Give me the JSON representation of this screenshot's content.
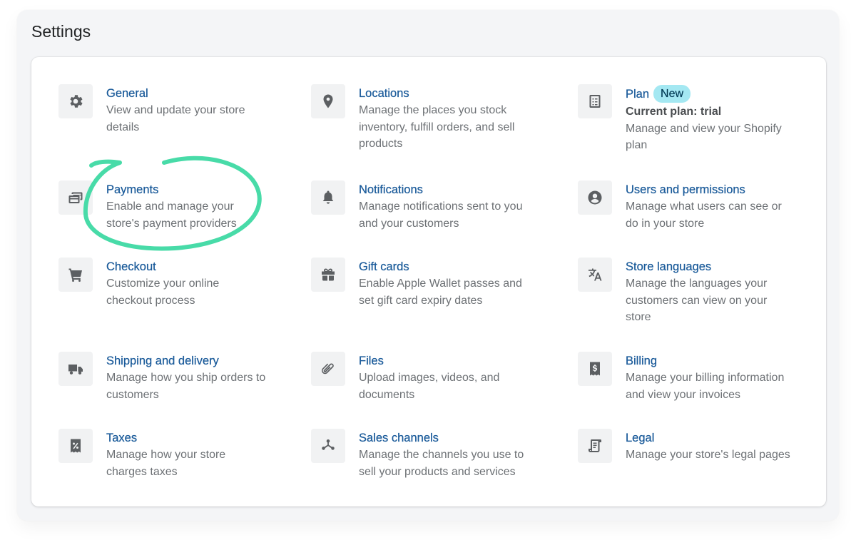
{
  "page": {
    "title": "Settings"
  },
  "annotation_color": "#3ed9a3",
  "settings": [
    {
      "key": "general",
      "title": "General",
      "description": "View and update your store details",
      "icon": "gear-icon"
    },
    {
      "key": "locations",
      "title": "Locations",
      "description": "Manage the places you stock inventory, fulfill orders, and sell products",
      "icon": "location-pin-icon"
    },
    {
      "key": "plan",
      "title": "Plan",
      "badge": "New",
      "subtitle": "Current plan: trial",
      "description": "Manage and view your Shopify plan",
      "icon": "plan-checklist-icon"
    },
    {
      "key": "payments",
      "title": "Payments",
      "description": "Enable and manage your store's payment providers",
      "icon": "payment-cards-icon"
    },
    {
      "key": "notifications",
      "title": "Notifications",
      "description": "Manage notifications sent to you and your customers",
      "icon": "bell-icon"
    },
    {
      "key": "users",
      "title": "Users and permissions",
      "description": "Manage what users can see or do in your store",
      "icon": "user-circle-icon"
    },
    {
      "key": "checkout",
      "title": "Checkout",
      "description": "Customize your online checkout process",
      "icon": "cart-icon"
    },
    {
      "key": "gift_cards",
      "title": "Gift cards",
      "description": "Enable Apple Wallet passes and set gift card expiry dates",
      "icon": "gift-icon"
    },
    {
      "key": "languages",
      "title": "Store languages",
      "description": "Manage the languages your customers can view on your store",
      "icon": "translate-icon"
    },
    {
      "key": "shipping",
      "title": "Shipping and delivery",
      "description": "Manage how you ship orders to customers",
      "icon": "truck-icon"
    },
    {
      "key": "files",
      "title": "Files",
      "description": "Upload images, videos, and documents",
      "icon": "paperclip-icon"
    },
    {
      "key": "billing",
      "title": "Billing",
      "description": "Manage your billing information and view your invoices",
      "icon": "dollar-receipt-icon"
    },
    {
      "key": "taxes",
      "title": "Taxes",
      "description": "Manage how your store charges taxes",
      "icon": "percent-receipt-icon"
    },
    {
      "key": "sales_channels",
      "title": "Sales channels",
      "description": "Manage the channels you use to sell your products and services",
      "icon": "channels-icon"
    },
    {
      "key": "legal",
      "title": "Legal",
      "description": "Manage your store's legal pages",
      "icon": "legal-document-icon"
    }
  ]
}
